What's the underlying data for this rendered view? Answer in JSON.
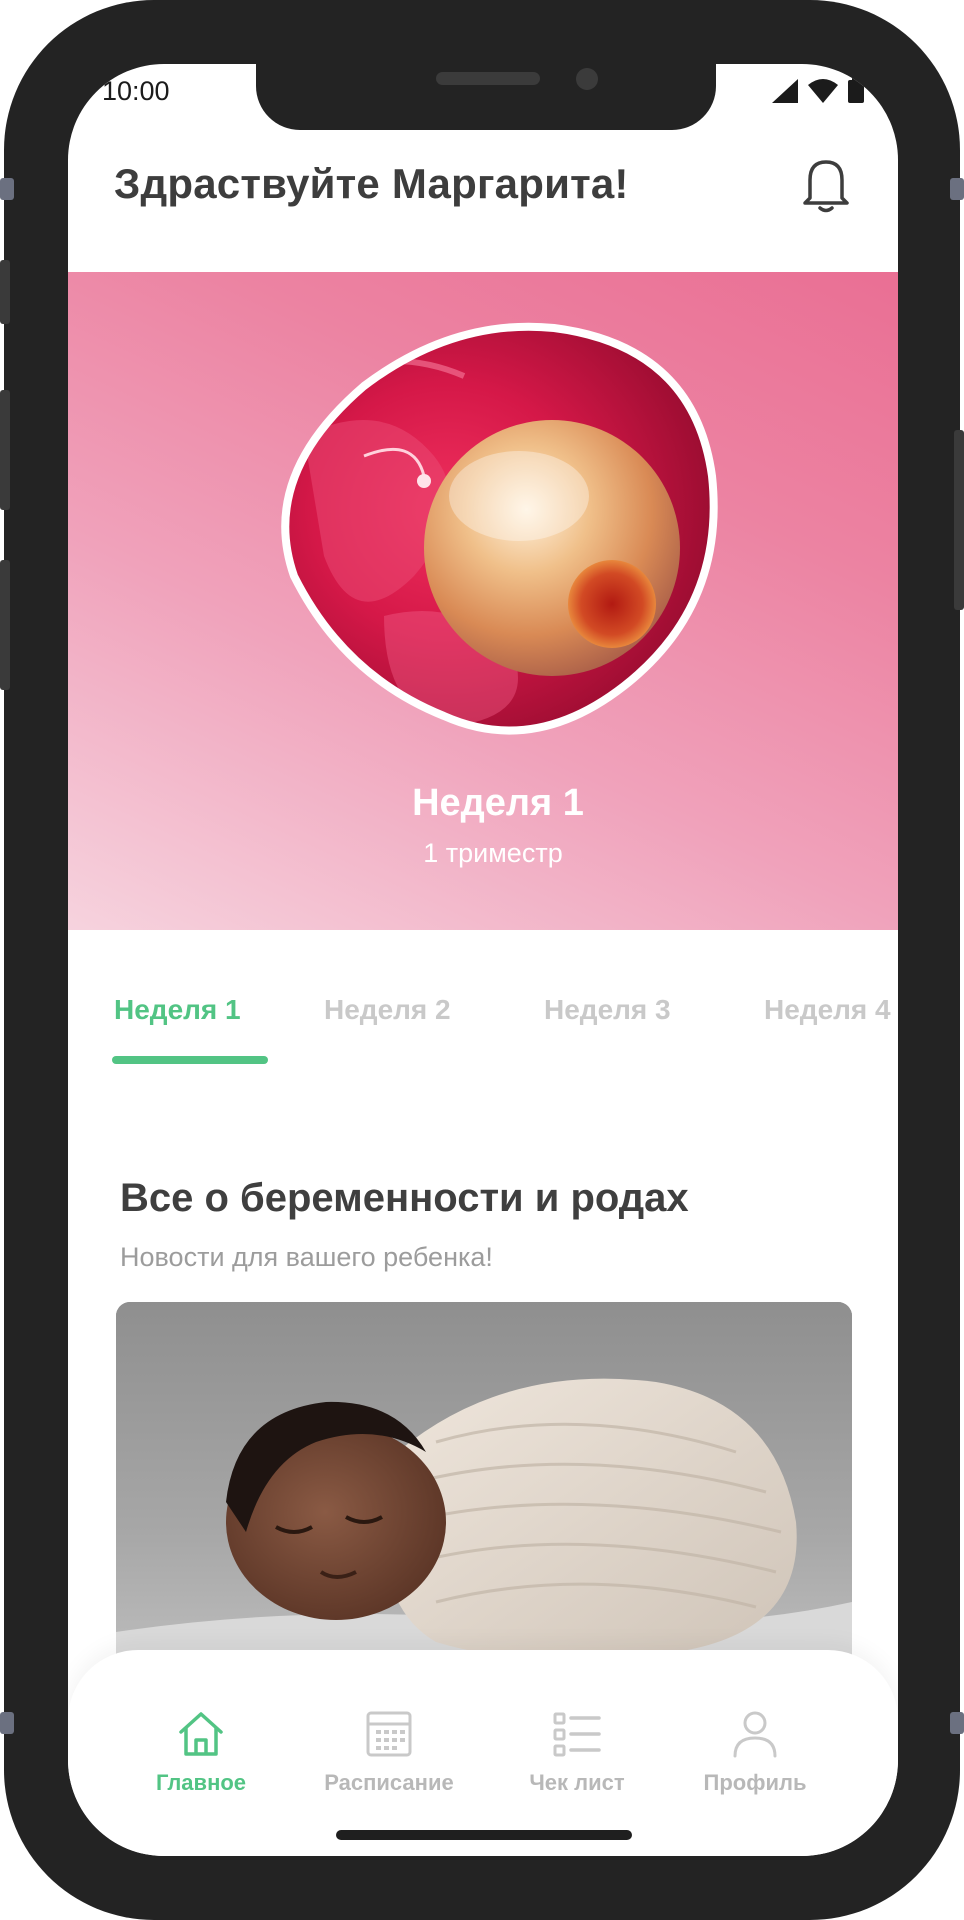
{
  "status_bar": {
    "time": "10:00"
  },
  "header": {
    "greeting": "Здраствуйте Маргарита!"
  },
  "hero": {
    "week": "Неделя 1",
    "trimester": "1 триместр"
  },
  "week_tabs": [
    {
      "label": "Неделя 1",
      "active": true
    },
    {
      "label": "Неделя 2",
      "active": false
    },
    {
      "label": "Неделя 3",
      "active": false
    },
    {
      "label": "Неделя 4",
      "active": false
    }
  ],
  "section": {
    "title": "Все о беременности и родах",
    "subtitle": "Новости для вашего ребенка!"
  },
  "bottom_nav": [
    {
      "label": "Главное",
      "icon": "home-icon",
      "active": true
    },
    {
      "label": "Расписание",
      "icon": "calendar-icon",
      "active": false
    },
    {
      "label": "Чек лист",
      "icon": "checklist-icon",
      "active": false
    },
    {
      "label": "Профиль",
      "icon": "profile-icon",
      "active": false
    }
  ],
  "colors": {
    "accent": "#52c484",
    "hero_pink": "#ec83a2",
    "text_dark": "#3d3d3d",
    "text_muted": "#9c9c9c",
    "inactive": "#c9c9c9"
  }
}
